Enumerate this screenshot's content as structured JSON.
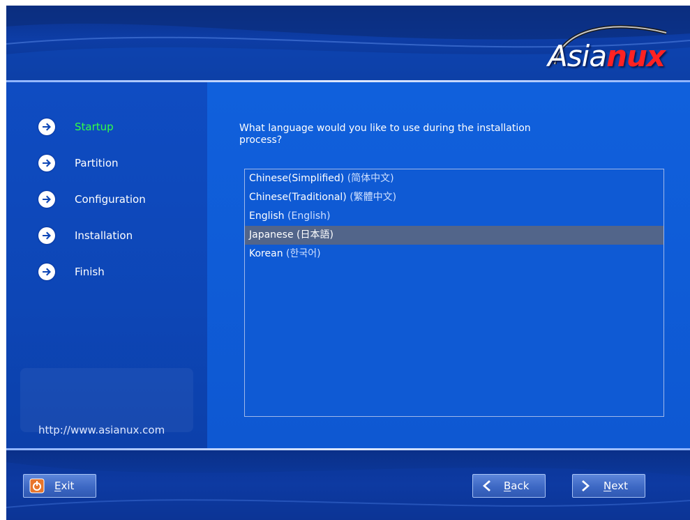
{
  "brand": {
    "logo_main": "Asia",
    "logo_accent": "nux"
  },
  "steps": [
    {
      "label": "Startup",
      "active": true
    },
    {
      "label": "Partition",
      "active": false
    },
    {
      "label": "Configuration",
      "active": false
    },
    {
      "label": "Installation",
      "active": false
    },
    {
      "label": "Finish",
      "active": false
    }
  ],
  "site_url": "http://www.asianux.com",
  "question": "What language would you like to use during the installation process?",
  "languages": [
    {
      "name": "Chinese(Simplified)",
      "native": "(简体中文)"
    },
    {
      "name": "Chinese(Traditional)",
      "native": "(繁體中文)"
    },
    {
      "name": "English",
      "native": "(English)"
    },
    {
      "name": "Japanese",
      "native": "(日本語)"
    },
    {
      "name": "Korean",
      "native": "(한국어)"
    }
  ],
  "selected_language": "Japanese",
  "buttons": {
    "exit_accesskey": "E",
    "exit_rest": "xit",
    "back_accesskey": "B",
    "back_rest": "ack",
    "next_accesskey": "N",
    "next_rest": "ext"
  },
  "colors": {
    "active_step": "#33ff44",
    "selection": "#52658a",
    "logo_accent": "#ff2222"
  }
}
